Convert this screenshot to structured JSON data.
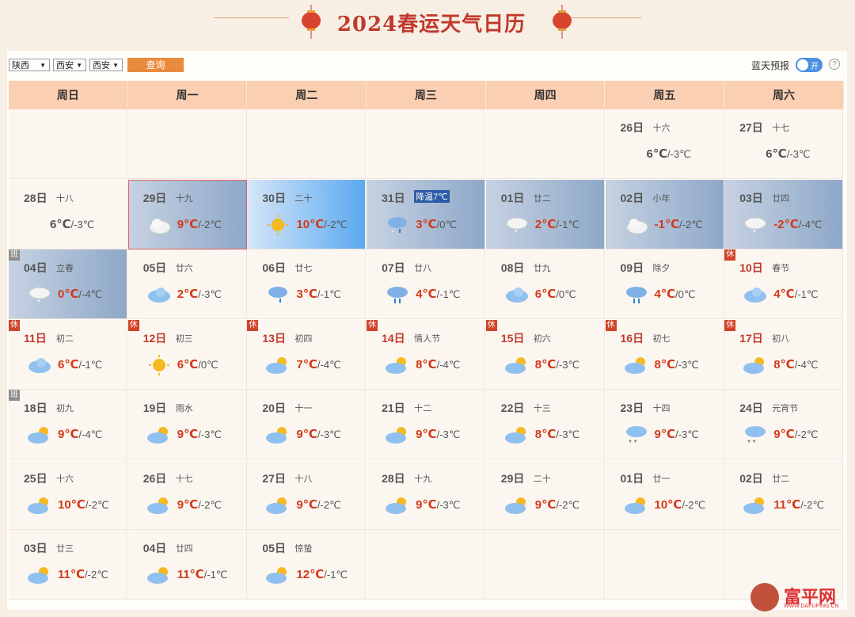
{
  "title": "2024春运天气日历",
  "filters": {
    "province": "陕西",
    "city": "西安",
    "district": "西安",
    "query_label": "查询"
  },
  "forecast": {
    "label": "蓝天预报",
    "toggle_text": "开",
    "help": "?"
  },
  "weekdays": [
    "周日",
    "周一",
    "周二",
    "周三",
    "周四",
    "周五",
    "周六"
  ],
  "days": [
    {
      "day": "",
      "lunar": "",
      "hi": "",
      "lo": ""
    },
    {
      "day": "",
      "lunar": "",
      "hi": "",
      "lo": ""
    },
    {
      "day": "",
      "lunar": "",
      "hi": "",
      "lo": ""
    },
    {
      "day": "",
      "lunar": "",
      "hi": "",
      "lo": ""
    },
    {
      "day": "",
      "lunar": "",
      "hi": "",
      "lo": ""
    },
    {
      "day": "26日",
      "lunar": "十六",
      "hi": "6℃",
      "lo": "/-3℃",
      "icon": "none",
      "style": "plain"
    },
    {
      "day": "27日",
      "lunar": "十七",
      "hi": "6℃",
      "lo": "/-3℃",
      "icon": "none",
      "style": "plain"
    },
    {
      "day": "28日",
      "lunar": "十八",
      "hi": "6℃",
      "lo": "/-3℃",
      "icon": "none",
      "style": "plain"
    },
    {
      "day": "29日",
      "lunar": "十九",
      "hi": "9℃",
      "lo": "/-2℃",
      "icon": "cloudy-icon",
      "style": "hl",
      "border": true
    },
    {
      "day": "30日",
      "lunar": "二十",
      "hi": "10℃",
      "lo": "/-2℃",
      "icon": "sunny-icon",
      "style": "hl2"
    },
    {
      "day": "31日",
      "lunar": "",
      "tag": "降温7℃",
      "hi": "3℃",
      "lo": "/0℃",
      "icon": "sleet-icon",
      "style": "hl"
    },
    {
      "day": "01日",
      "lunar": "廿二",
      "hi": "2℃",
      "lo": "/-1℃",
      "icon": "snow-icon",
      "style": "hl"
    },
    {
      "day": "02日",
      "lunar": "小年",
      "hi": "-1℃",
      "lo": "/-2℃",
      "icon": "cloudy-icon",
      "style": "hl"
    },
    {
      "day": "03日",
      "lunar": "廿四",
      "hi": "-2℃",
      "lo": "/-4℃",
      "icon": "snow-icon",
      "style": "hl"
    },
    {
      "day": "04日",
      "lunar": "立春",
      "hi": "0℃",
      "lo": "/-4℃",
      "icon": "snow-icon",
      "style": "hl",
      "badge": "班"
    },
    {
      "day": "05日",
      "lunar": "廿六",
      "hi": "2℃",
      "lo": "/-3℃",
      "icon": "cloud-blue-icon",
      "style": "plain"
    },
    {
      "day": "06日",
      "lunar": "廿七",
      "hi": "3℃",
      "lo": "/-1℃",
      "icon": "sleet-icon",
      "style": "plain"
    },
    {
      "day": "07日",
      "lunar": "廿八",
      "hi": "4℃",
      "lo": "/-1℃",
      "icon": "rain-icon",
      "style": "plain"
    },
    {
      "day": "08日",
      "lunar": "廿九",
      "hi": "6℃",
      "lo": "/0℃",
      "icon": "cloud-blue-icon",
      "style": "plain"
    },
    {
      "day": "09日",
      "lunar": "除夕",
      "hi": "4℃",
      "lo": "/0℃",
      "icon": "rain-icon",
      "style": "plain"
    },
    {
      "day": "10日",
      "lunar": "春节",
      "hi": "4℃",
      "lo": "/-1℃",
      "icon": "cloud-blue-icon",
      "style": "plain",
      "badge": "休",
      "red": true
    },
    {
      "day": "11日",
      "lunar": "初二",
      "hi": "6℃",
      "lo": "/-1℃",
      "icon": "cloud-blue-icon",
      "style": "plain",
      "badge": "休",
      "red": true
    },
    {
      "day": "12日",
      "lunar": "初三",
      "hi": "6℃",
      "lo": "/0℃",
      "icon": "sunny-icon",
      "style": "plain",
      "badge": "休",
      "red": true
    },
    {
      "day": "13日",
      "lunar": "初四",
      "hi": "7℃",
      "lo": "/-4℃",
      "icon": "partly-cloudy-icon",
      "style": "plain",
      "badge": "休",
      "red": true
    },
    {
      "day": "14日",
      "lunar": "情人节",
      "hi": "8℃",
      "lo": "/-4℃",
      "icon": "partly-cloudy-icon",
      "style": "plain",
      "badge": "休",
      "red": true
    },
    {
      "day": "15日",
      "lunar": "初六",
      "hi": "8℃",
      "lo": "/-3℃",
      "icon": "partly-cloudy-icon",
      "style": "plain",
      "badge": "休",
      "red": true
    },
    {
      "day": "16日",
      "lunar": "初七",
      "hi": "8℃",
      "lo": "/-3℃",
      "icon": "partly-cloudy-icon",
      "style": "plain",
      "badge": "休",
      "red": true
    },
    {
      "day": "17日",
      "lunar": "初八",
      "hi": "8℃",
      "lo": "/-4℃",
      "icon": "partly-cloudy-icon",
      "style": "plain",
      "badge": "休",
      "red": true
    },
    {
      "day": "18日",
      "lunar": "初九",
      "hi": "9℃",
      "lo": "/-4℃",
      "icon": "partly-cloudy-icon",
      "style": "plain",
      "badge": "班"
    },
    {
      "day": "19日",
      "lunar": "雨水",
      "hi": "9℃",
      "lo": "/-3℃",
      "icon": "partly-cloudy-icon",
      "style": "plain"
    },
    {
      "day": "20日",
      "lunar": "十一",
      "hi": "9℃",
      "lo": "/-3℃",
      "icon": "partly-cloudy-icon",
      "style": "plain"
    },
    {
      "day": "21日",
      "lunar": "十二",
      "hi": "9℃",
      "lo": "/-3℃",
      "icon": "partly-cloudy-icon",
      "style": "plain"
    },
    {
      "day": "22日",
      "lunar": "十三",
      "hi": "8℃",
      "lo": "/-3℃",
      "icon": "partly-cloudy-icon",
      "style": "plain"
    },
    {
      "day": "23日",
      "lunar": "十四",
      "hi": "9℃",
      "lo": "/-3℃",
      "icon": "snow-blue-icon",
      "style": "plain"
    },
    {
      "day": "24日",
      "lunar": "元宵节",
      "hi": "9℃",
      "lo": "/-2℃",
      "icon": "snow-blue-icon",
      "style": "plain"
    },
    {
      "day": "25日",
      "lunar": "十六",
      "hi": "10℃",
      "lo": "/-2℃",
      "icon": "partly-cloudy-icon",
      "style": "plain"
    },
    {
      "day": "26日",
      "lunar": "十七",
      "hi": "9℃",
      "lo": "/-2℃",
      "icon": "partly-cloudy-icon",
      "style": "plain"
    },
    {
      "day": "27日",
      "lunar": "十八",
      "hi": "9℃",
      "lo": "/-2℃",
      "icon": "partly-cloudy-icon",
      "style": "plain"
    },
    {
      "day": "28日",
      "lunar": "十九",
      "hi": "9℃",
      "lo": "/-3℃",
      "icon": "partly-cloudy-icon",
      "style": "plain"
    },
    {
      "day": "29日",
      "lunar": "二十",
      "hi": "9℃",
      "lo": "/-2℃",
      "icon": "partly-cloudy-icon",
      "style": "plain"
    },
    {
      "day": "01日",
      "lunar": "廿一",
      "hi": "10℃",
      "lo": "/-2℃",
      "icon": "partly-cloudy-icon",
      "style": "plain"
    },
    {
      "day": "02日",
      "lunar": "廿二",
      "hi": "11℃",
      "lo": "/-2℃",
      "icon": "partly-cloudy-icon",
      "style": "plain"
    },
    {
      "day": "03日",
      "lunar": "廿三",
      "hi": "11℃",
      "lo": "/-2℃",
      "icon": "partly-cloudy-icon",
      "style": "plain"
    },
    {
      "day": "04日",
      "lunar": "廿四",
      "hi": "11℃",
      "lo": "/-1℃",
      "icon": "partly-cloudy-icon",
      "style": "plain"
    },
    {
      "day": "05日",
      "lunar": "惊蛰",
      "hi": "12℃",
      "lo": "/-1℃",
      "icon": "partly-cloudy-icon",
      "style": "plain"
    },
    {
      "day": "",
      "lunar": "",
      "hi": "",
      "lo": ""
    },
    {
      "day": "",
      "lunar": "",
      "hi": "",
      "lo": ""
    },
    {
      "day": "",
      "lunar": "",
      "hi": "",
      "lo": ""
    },
    {
      "day": "",
      "lunar": "",
      "hi": "",
      "lo": ""
    }
  ],
  "watermark": {
    "name": "富平网",
    "url": "WWW.DAFUPING.CN"
  }
}
